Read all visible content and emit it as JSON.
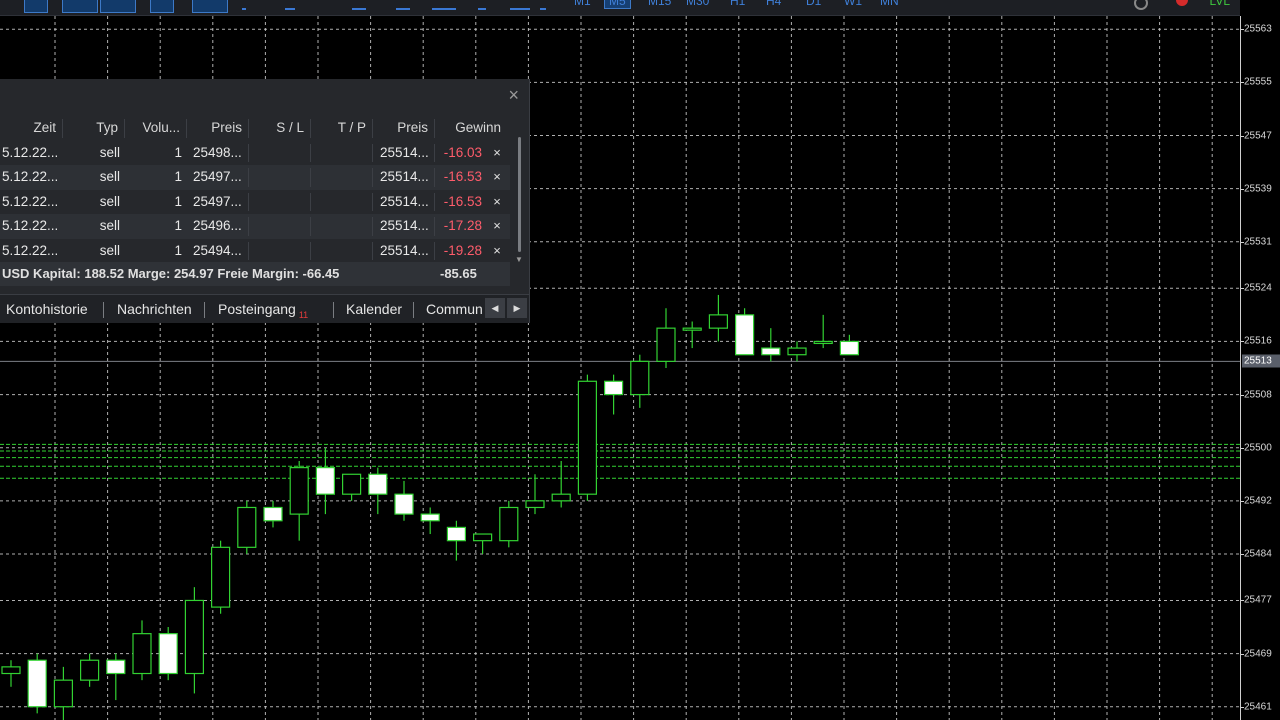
{
  "toolbar": {
    "timeframes": [
      "M1",
      "M5",
      "M15",
      "M30",
      "H1",
      "H4",
      "D1",
      "W1",
      "MN"
    ],
    "active_timeframe": "M5",
    "level_indicator": "LVL"
  },
  "chart": {
    "type": "candlestick",
    "background": "#000000",
    "up_color": "#32d232",
    "down_color": "#ffffff",
    "grid": true,
    "ylim": [
      25459,
      25565
    ],
    "current_price": 25513,
    "price_labels": [
      "25563",
      "25555",
      "25547",
      "25539",
      "25531",
      "25524",
      "25516",
      "25508",
      "25500",
      "25492",
      "25484",
      "25477",
      "25469",
      "25461"
    ],
    "order_levels": [
      25500.5,
      25499.5,
      25498.5,
      25497.2,
      25495.4
    ],
    "candles": [
      {
        "o": 25466,
        "h": 25468,
        "l": 25464,
        "c": 25467
      },
      {
        "o": 25468,
        "h": 25469,
        "l": 25460,
        "c": 25461
      },
      {
        "o": 25461,
        "h": 25467,
        "l": 25459,
        "c": 25465
      },
      {
        "o": 25465,
        "h": 25469,
        "l": 25464,
        "c": 25468
      },
      {
        "o": 25468,
        "h": 25469,
        "l": 25462,
        "c": 25466
      },
      {
        "o": 25466,
        "h": 25474,
        "l": 25465,
        "c": 25472
      },
      {
        "o": 25472,
        "h": 25473,
        "l": 25465,
        "c": 25466
      },
      {
        "o": 25466,
        "h": 25479,
        "l": 25463,
        "c": 25477
      },
      {
        "o": 25476,
        "h": 25486,
        "l": 25475,
        "c": 25485
      },
      {
        "o": 25485,
        "h": 25492,
        "l": 25484,
        "c": 25491
      },
      {
        "o": 25491,
        "h": 25492,
        "l": 25488,
        "c": 25489
      },
      {
        "o": 25490,
        "h": 25498,
        "l": 25486,
        "c": 25497
      },
      {
        "o": 25497,
        "h": 25500,
        "l": 25490,
        "c": 25493
      },
      {
        "o": 25493,
        "h": 25496,
        "l": 25492,
        "c": 25496
      },
      {
        "o": 25496,
        "h": 25497,
        "l": 25490,
        "c": 25493
      },
      {
        "o": 25493,
        "h": 25495,
        "l": 25489,
        "c": 25490
      },
      {
        "o": 25490,
        "h": 25491,
        "l": 25487,
        "c": 25489
      },
      {
        "o": 25488,
        "h": 25489,
        "l": 25483,
        "c": 25486
      },
      {
        "o": 25486,
        "h": 25487,
        "l": 25484,
        "c": 25487
      },
      {
        "o": 25486,
        "h": 25492,
        "l": 25485,
        "c": 25491
      },
      {
        "o": 25491,
        "h": 25496,
        "l": 25490,
        "c": 25492
      },
      {
        "o": 25492,
        "h": 25498,
        "l": 25491,
        "c": 25493
      },
      {
        "o": 25493,
        "h": 25511,
        "l": 25492,
        "c": 25510
      },
      {
        "o": 25510,
        "h": 25511,
        "l": 25505,
        "c": 25508
      },
      {
        "o": 25508,
        "h": 25514,
        "l": 25506,
        "c": 25513
      },
      {
        "o": 25513,
        "h": 25521,
        "l": 25512,
        "c": 25518
      },
      {
        "o": 25518,
        "h": 25519,
        "l": 25515,
        "c": 25518
      },
      {
        "o": 25518,
        "h": 25523,
        "l": 25516,
        "c": 25520
      },
      {
        "o": 25520,
        "h": 25521,
        "l": 25514,
        "c": 25514
      },
      {
        "o": 25515,
        "h": 25518,
        "l": 25513,
        "c": 25514
      },
      {
        "o": 25514,
        "h": 25516,
        "l": 25513,
        "c": 25515
      },
      {
        "o": 25516,
        "h": 25520,
        "l": 25515,
        "c": 25516
      },
      {
        "o": 25516,
        "h": 25517,
        "l": 25514,
        "c": 25514
      }
    ]
  },
  "positions": {
    "headers": [
      "Zeit",
      "Typ",
      "Volu...",
      "Preis",
      "S / L",
      "T / P",
      "Preis",
      "Gewinn"
    ],
    "rows": [
      {
        "time": "5.12.22...",
        "type": "sell",
        "volume": "1",
        "open_price": "25498...",
        "sl": "",
        "tp": "",
        "price": "25514...",
        "profit": "-16.03",
        "close": "×"
      },
      {
        "time": "5.12.22...",
        "type": "sell",
        "volume": "1",
        "open_price": "25497...",
        "sl": "",
        "tp": "",
        "price": "25514...",
        "profit": "-16.53",
        "close": "×"
      },
      {
        "time": "5.12.22...",
        "type": "sell",
        "volume": "1",
        "open_price": "25497...",
        "sl": "",
        "tp": "",
        "price": "25514...",
        "profit": "-16.53",
        "close": "×"
      },
      {
        "time": "5.12.22...",
        "type": "sell",
        "volume": "1",
        "open_price": "25496...",
        "sl": "",
        "tp": "",
        "price": "25514...",
        "profit": "-17.28",
        "close": "×"
      },
      {
        "time": "5.12.22...",
        "type": "sell",
        "volume": "1",
        "open_price": "25494...",
        "sl": "",
        "tp": "",
        "price": "25514...",
        "profit": "-19.28",
        "close": "×"
      }
    ],
    "summary": {
      "text": "USD  Kapital: 188.52  Marge: 254.97  Freie Margin: -66.45",
      "total": "-85.65"
    }
  },
  "panel": {
    "close": "×"
  },
  "tabs": {
    "items": [
      {
        "label": "Kontohistorie"
      },
      {
        "label": "Nachrichten"
      },
      {
        "label": "Posteingang",
        "badge": "11"
      },
      {
        "label": "Kalender"
      },
      {
        "label": "Commun"
      }
    ],
    "prev": "◀",
    "next": "▶"
  }
}
